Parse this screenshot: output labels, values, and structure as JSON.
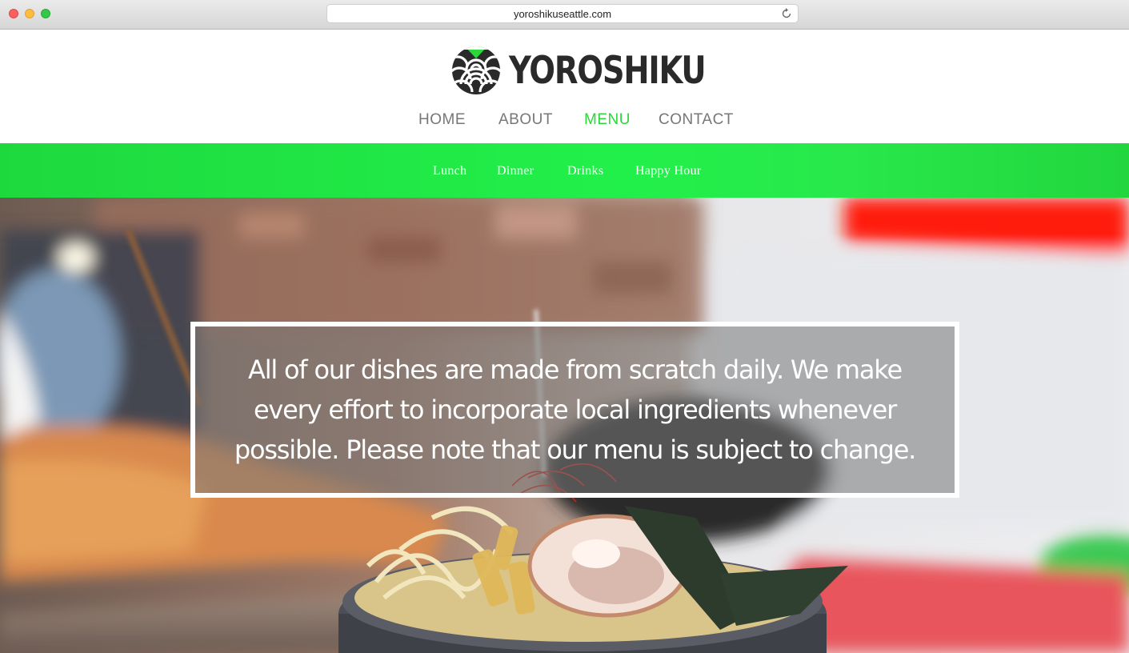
{
  "browser": {
    "url": "yoroshikuseattle.com"
  },
  "brand": {
    "name": "YOROSHIKU",
    "accent_color": "#22e34a",
    "logo_icon": "wave-seal-icon"
  },
  "main_nav": {
    "items": [
      {
        "label": "HOME",
        "active": false
      },
      {
        "label": "ABOUT",
        "active": false
      },
      {
        "label": "MENU",
        "active": true
      },
      {
        "label": "CONTACT",
        "active": false
      }
    ]
  },
  "sub_nav": {
    "items": [
      {
        "label": "Lunch"
      },
      {
        "label": "Dinner"
      },
      {
        "label": "Drinks"
      },
      {
        "label": "Happy Hour"
      }
    ]
  },
  "hero": {
    "notice": "All of our dishes are made from scratch daily. We make every effort to incorporate local ingredients whenever possible. Please note that our menu is subject to change."
  }
}
